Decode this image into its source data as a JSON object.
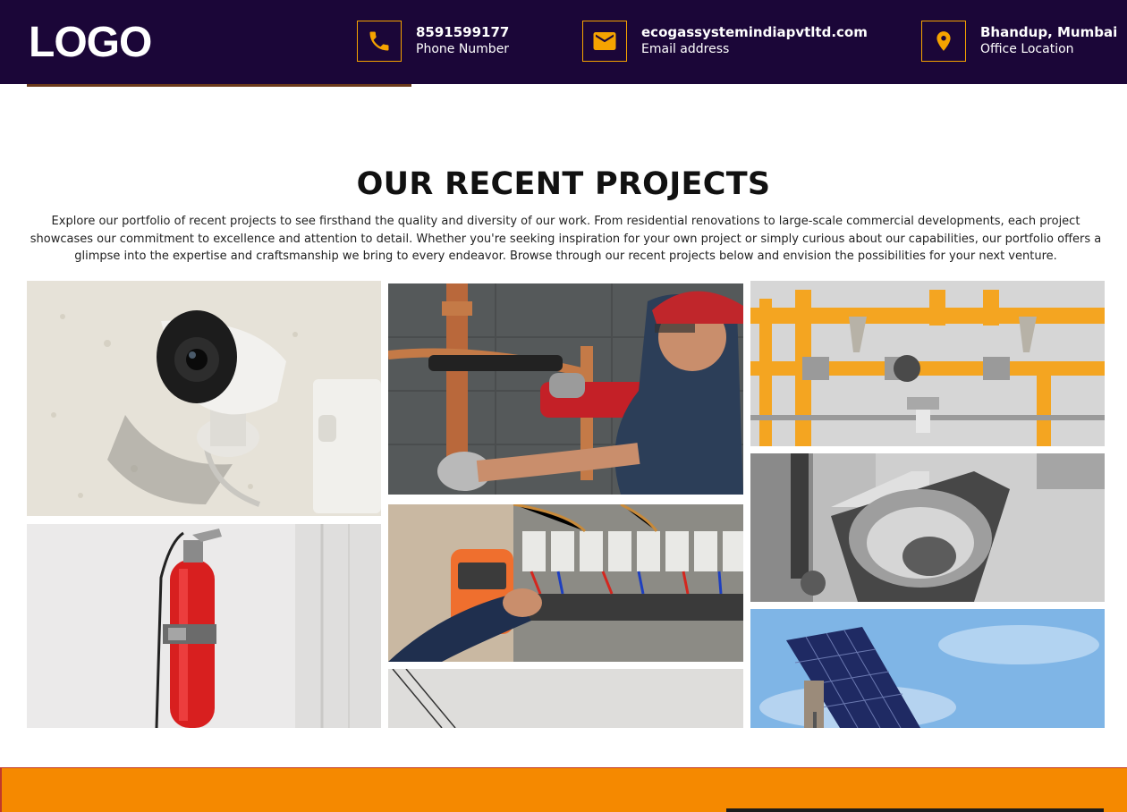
{
  "header": {
    "logo_text": "LOGO",
    "phone": {
      "value": "8591599177",
      "label": "Phone Number",
      "icon": "phone-icon"
    },
    "email": {
      "value": "ecogassystemindiapvtltd.com",
      "label": "Email address",
      "icon": "mail-icon"
    },
    "location": {
      "value": "Bhandup, Mumbai",
      "label": "Office Location",
      "icon": "map-pin-icon"
    }
  },
  "projects": {
    "title": "OUR RECENT PROJECTS",
    "description": "Explore our portfolio of recent projects to see firsthand the quality and diversity of our work. From residential renovations to large-scale commercial developments, each project showcases our commitment to excellence and attention to detail. Whether you're seeking inspiration for your own project or simply curious about our capabilities, our portfolio offers a glimpse into the expertise and craftsmanship we bring to every endeavor. Browse through our recent projects below and envision the possibilities for your next venture."
  },
  "colors": {
    "header_bg": "#1b0638",
    "accent": "#f5a300",
    "footer_band": "#f58900"
  }
}
